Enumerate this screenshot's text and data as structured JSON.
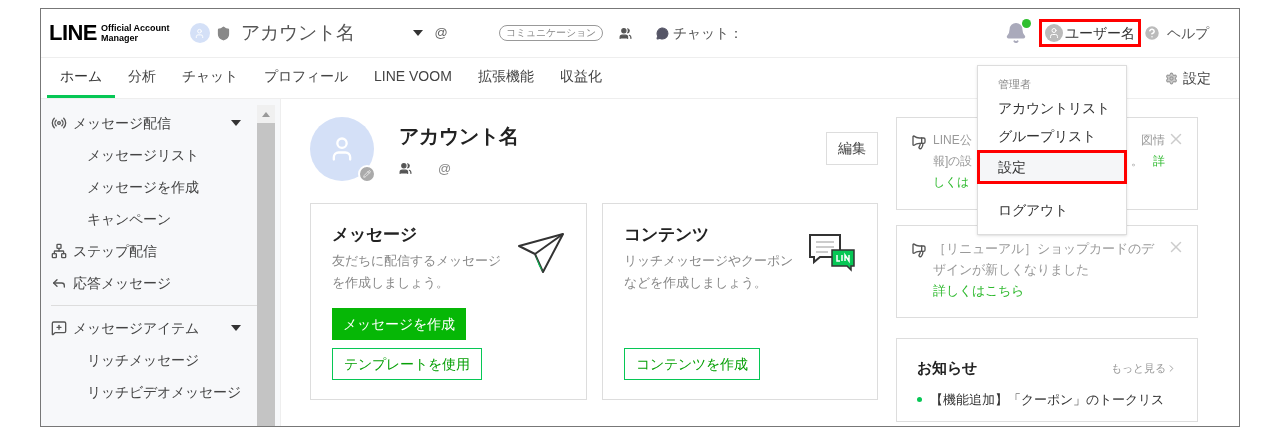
{
  "header": {
    "logo": {
      "word": "LINE",
      "sub": [
        "Official Account",
        "Manager"
      ]
    },
    "account_name": "アカウント名",
    "at": "@",
    "badge": "コミュニケーション",
    "chat_label": "チャット：",
    "has_unread": true,
    "user_name": "ユーザー名",
    "user_highlighted": true,
    "help": "ヘルプ"
  },
  "tabs": [
    {
      "label": "ホーム",
      "selected": true
    },
    {
      "label": "分析",
      "selected": false
    },
    {
      "label": "チャット",
      "selected": false
    },
    {
      "label": "プロフィール",
      "selected": false
    },
    {
      "label": "LINE VOOM",
      "selected": false
    },
    {
      "label": "拡張機能",
      "selected": false
    },
    {
      "label": "収益化",
      "selected": false
    }
  ],
  "settings_link": "設定",
  "sidebar": {
    "groups": [
      {
        "items": [
          {
            "kind": "broadcast",
            "label": "メッセージ配信",
            "expanded": true,
            "children": [
              {
                "label": "メッセージリスト"
              },
              {
                "label": "メッセージを作成"
              },
              {
                "label": "キャンペーン"
              }
            ]
          },
          {
            "kind": "step",
            "label": "ステップ配信"
          },
          {
            "kind": "reply",
            "label": "応答メッセージ"
          }
        ]
      },
      {
        "items": [
          {
            "kind": "item",
            "label": "メッセージアイテム",
            "expanded": true,
            "children": [
              {
                "label": "リッチメッセージ"
              },
              {
                "label": "リッチビデオメッセージ"
              }
            ]
          }
        ]
      }
    ]
  },
  "profile": {
    "name": "アカウント名",
    "at": "@",
    "edit": "編集"
  },
  "cards": [
    {
      "kind": "message",
      "title": "メッセージ",
      "description": "友だちに配信するメッセージを作成しましょう。",
      "buttons": [
        {
          "label": "メッセージを作成",
          "primary": true
        },
        {
          "label": "テンプレートを使用",
          "primary": false
        }
      ]
    },
    {
      "kind": "content",
      "title": "コンテンツ",
      "description": "リッチメッセージやクーポンなどを作成しましょう。",
      "buttons": [
        {
          "label": "コンテンツを作成",
          "primary": false
        }
      ]
    }
  ],
  "notices": [
    {
      "lines": [
        [
          {
            "text": "LINE公",
            "link": false
          },
          {
            "text": "図情",
            "link": false
          }
        ],
        [
          {
            "text": "報]の設",
            "link": false
          },
          {
            "text": "。",
            "link": false
          },
          {
            "text": "詳",
            "link": true
          }
        ],
        [
          {
            "text": "しくは",
            "link": true
          }
        ]
      ]
    },
    {
      "text": "［リニューアル］ショップカードのデザインが新しくなりました",
      "link": "詳しくはこちら"
    }
  ],
  "news": {
    "title": "お知らせ",
    "more": "もっと見る",
    "items": [
      {
        "text": "【機能追加】「クーポン」のトークリス",
        "unread": true
      }
    ]
  },
  "menu": {
    "header": "管理者",
    "groups": [
      {
        "items": [
          {
            "label": "アカウントリスト",
            "highlighted": false
          },
          {
            "label": "グループリスト",
            "highlighted": false
          },
          {
            "label": "設定",
            "highlighted": true
          }
        ]
      },
      {
        "items": [
          {
            "label": "ログアウト",
            "highlighted": false
          }
        ]
      }
    ]
  }
}
